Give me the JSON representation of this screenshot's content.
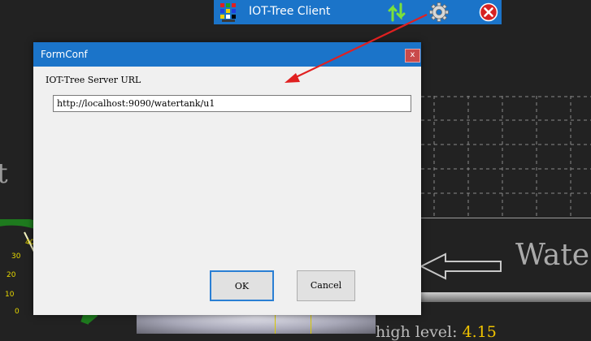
{
  "client": {
    "title": "IOT-Tree Client",
    "icons": [
      "logo-icon",
      "sync-icon",
      "gear-icon",
      "close-icon"
    ],
    "accent": "#1b74c9"
  },
  "dialog": {
    "title": "FormConf",
    "close_label": "x",
    "server_url_label": "IOT-Tree Server URL",
    "server_url_value": "http://localhost:9090/watertank/u1",
    "ok_label": "OK",
    "cancel_label": "Cancel"
  },
  "background": {
    "partial_text_left": "t",
    "partial_title_right": "Wate",
    "high_level_label": "high level:",
    "high_level_value": "4.15",
    "gauge_ticks": [
      "40",
      "30",
      "20",
      "10",
      "0"
    ]
  },
  "annotation": {
    "arrow_color": "#e02020"
  }
}
